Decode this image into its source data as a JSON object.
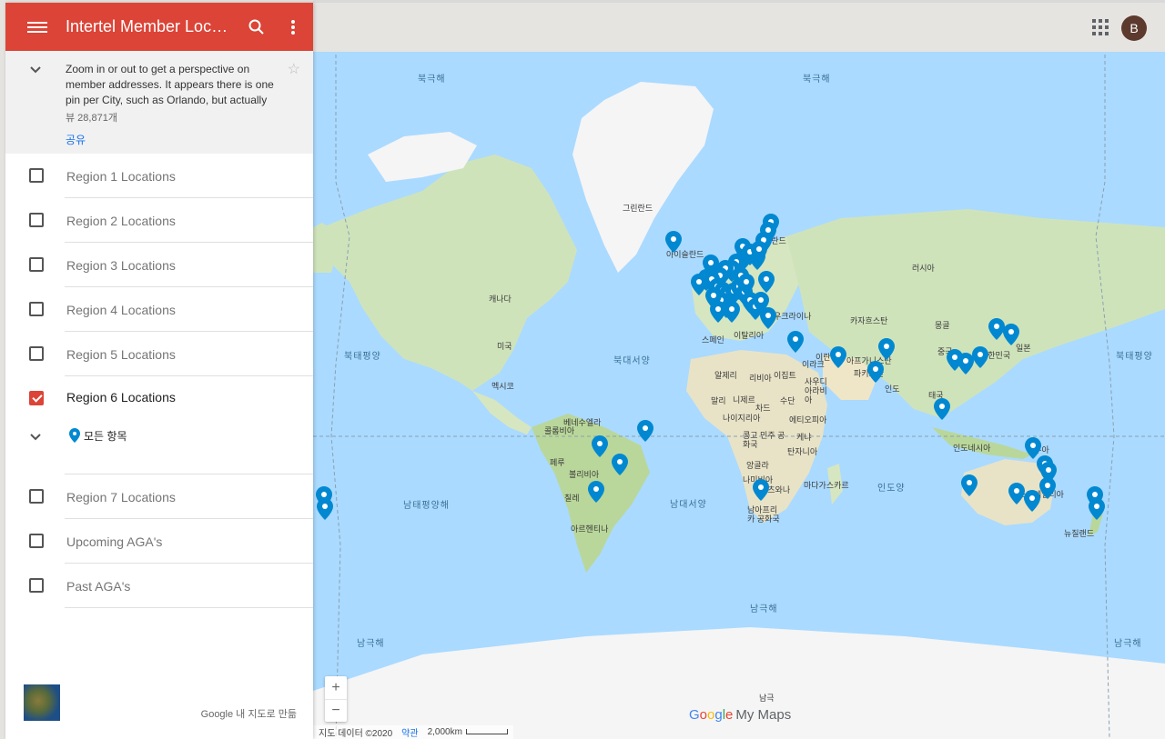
{
  "header": {
    "title": "Intertel Member Locati...",
    "menu_icon": "hamburger-icon",
    "search_icon": "search-icon",
    "more_icon": "more-vert-icon"
  },
  "description": {
    "text": "Zoom in or out to get a perspective on member addresses. It appears there is one pin per City, such as Orlando, but actually",
    "views": "뷰 28,871개",
    "share": "공유"
  },
  "layers": [
    {
      "label": "Region 1 Locations",
      "checked": false
    },
    {
      "label": "Region 2 Locations",
      "checked": false
    },
    {
      "label": "Region 3 Locations",
      "checked": false
    },
    {
      "label": "Region 4 Locations",
      "checked": false
    },
    {
      "label": "Region 5 Locations",
      "checked": false
    },
    {
      "label": "Region 6 Locations",
      "checked": true
    },
    {
      "label": "Region 7 Locations",
      "checked": false
    },
    {
      "label": "Upcoming AGA's",
      "checked": false
    },
    {
      "label": "Past AGA's",
      "checked": false
    }
  ],
  "sublayer": {
    "label": "모든 항목"
  },
  "footer": {
    "credit": "Google 내 지도로 만듦"
  },
  "account": {
    "initial": "B",
    "avatar_color": "#5d3a2e"
  },
  "map": {
    "zoom_in": "+",
    "zoom_out": "−",
    "attribution": "지도 데이터 ©2020",
    "terms": "약관",
    "scale": "2,000km",
    "logo": "Google My Maps",
    "pin_color": "#0288d1",
    "oceans": [
      "북극해",
      "북극해",
      "북태평양",
      "북대서양",
      "북태평양",
      "남태평양해",
      "남대서양",
      "인도양",
      "남극해",
      "남극해",
      "남극해"
    ],
    "labels": [
      "그린란드",
      "아이슬란드",
      "캐나다",
      "미국",
      "멕시코",
      "러시아",
      "카자흐스탄",
      "몽골",
      "중국",
      "대한민국",
      "일본",
      "인도",
      "이란",
      "이라크",
      "사우디 아라비아",
      "아프가니스탄",
      "파키스탄",
      "태국",
      "인도네시아",
      "파푸아",
      "오스트레일리아",
      "뉴질랜드",
      "알제리",
      "리비아",
      "이집트",
      "말리",
      "니제르",
      "차드",
      "수단",
      "나이지리아",
      "에티오피아",
      "케냐",
      "콩고 민주 공화국",
      "탄자니아",
      "앙골라",
      "나미비아",
      "보츠와나",
      "마다가스카르",
      "남아프리카 공화국",
      "베네수엘라",
      "콜롬비아",
      "페루",
      "볼리비아",
      "칠레",
      "아르헨티나",
      "스페인",
      "이탈리아",
      "우크라이나",
      "핀란드",
      "남극"
    ]
  }
}
